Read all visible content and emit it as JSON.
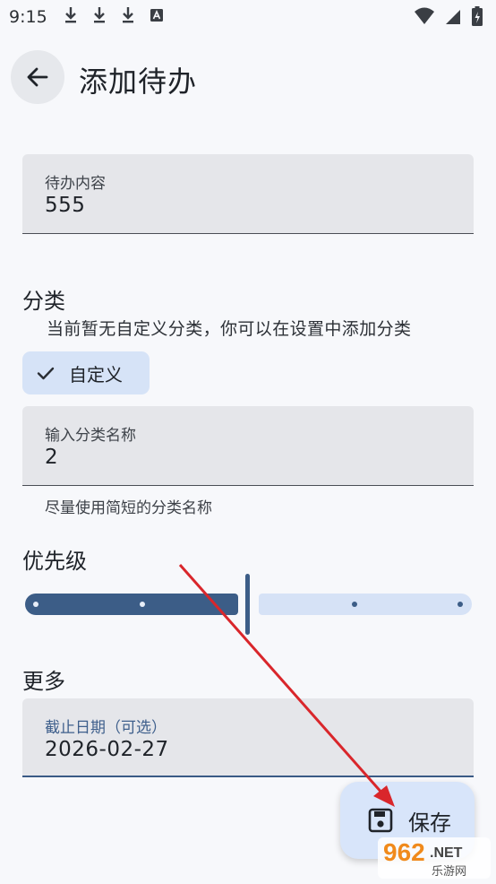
{
  "status_bar": {
    "time": "9:15",
    "left_icons": [
      "download-icon",
      "download-icon",
      "download-icon",
      "a-icon"
    ],
    "right_icons": [
      "wifi-icon",
      "signal-icon",
      "battery-icon"
    ]
  },
  "header": {
    "back_icon": "arrow-back-icon",
    "title": "添加待办"
  },
  "todo_field": {
    "label": "待办内容",
    "value": "555"
  },
  "category": {
    "title": "分类",
    "info": "当前暂无自定义分类，你可以在设置中添加分类",
    "chip_label": "自定义",
    "chip_selected": true,
    "name_field_label": "输入分类名称",
    "name_field_value": "2",
    "helper": "尽量使用简短的分类名称"
  },
  "priority": {
    "title": "优先级",
    "level": 0.5,
    "steps": 5
  },
  "more": {
    "title": "更多",
    "deadline_label": "截止日期（可选）",
    "deadline_value": "2026-02-27"
  },
  "fab": {
    "icon": "save-icon",
    "label": "保存"
  },
  "watermark": {
    "brand": "962",
    "suffix": ".NET",
    "subtitle": "乐游网"
  },
  "colors": {
    "primary": "#3c5d87",
    "primary_container": "#d6e2f6",
    "annotation_arrow": "#d9262b"
  }
}
